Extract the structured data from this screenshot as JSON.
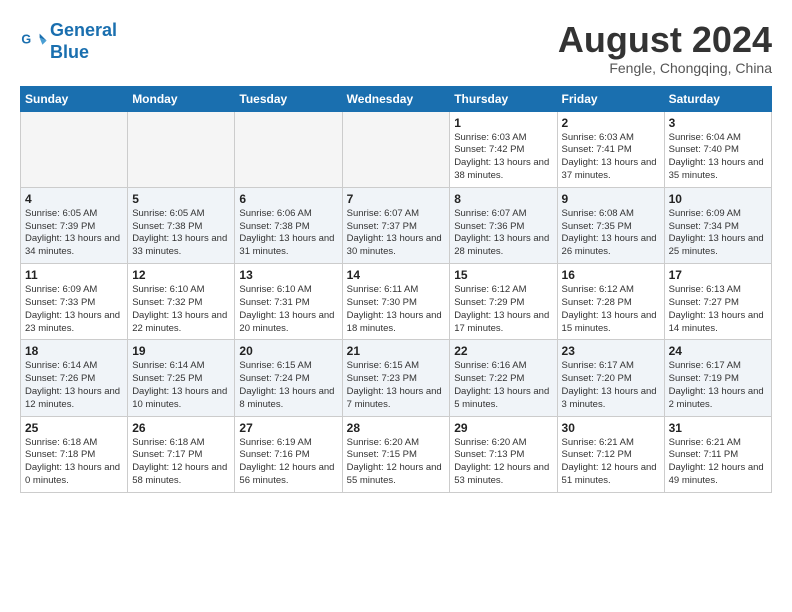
{
  "header": {
    "logo_line1": "General",
    "logo_line2": "Blue",
    "month_year": "August 2024",
    "location": "Fengle, Chongqing, China"
  },
  "weekdays": [
    "Sunday",
    "Monday",
    "Tuesday",
    "Wednesday",
    "Thursday",
    "Friday",
    "Saturday"
  ],
  "weeks": [
    [
      {
        "day": "",
        "empty": true
      },
      {
        "day": "",
        "empty": true
      },
      {
        "day": "",
        "empty": true
      },
      {
        "day": "",
        "empty": true
      },
      {
        "day": "1",
        "sunrise": "6:03 AM",
        "sunset": "7:42 PM",
        "daylight": "13 hours and 38 minutes."
      },
      {
        "day": "2",
        "sunrise": "6:03 AM",
        "sunset": "7:41 PM",
        "daylight": "13 hours and 37 minutes."
      },
      {
        "day": "3",
        "sunrise": "6:04 AM",
        "sunset": "7:40 PM",
        "daylight": "13 hours and 35 minutes."
      }
    ],
    [
      {
        "day": "4",
        "sunrise": "6:05 AM",
        "sunset": "7:39 PM",
        "daylight": "13 hours and 34 minutes."
      },
      {
        "day": "5",
        "sunrise": "6:05 AM",
        "sunset": "7:38 PM",
        "daylight": "13 hours and 33 minutes."
      },
      {
        "day": "6",
        "sunrise": "6:06 AM",
        "sunset": "7:38 PM",
        "daylight": "13 hours and 31 minutes."
      },
      {
        "day": "7",
        "sunrise": "6:07 AM",
        "sunset": "7:37 PM",
        "daylight": "13 hours and 30 minutes."
      },
      {
        "day": "8",
        "sunrise": "6:07 AM",
        "sunset": "7:36 PM",
        "daylight": "13 hours and 28 minutes."
      },
      {
        "day": "9",
        "sunrise": "6:08 AM",
        "sunset": "7:35 PM",
        "daylight": "13 hours and 26 minutes."
      },
      {
        "day": "10",
        "sunrise": "6:09 AM",
        "sunset": "7:34 PM",
        "daylight": "13 hours and 25 minutes."
      }
    ],
    [
      {
        "day": "11",
        "sunrise": "6:09 AM",
        "sunset": "7:33 PM",
        "daylight": "13 hours and 23 minutes."
      },
      {
        "day": "12",
        "sunrise": "6:10 AM",
        "sunset": "7:32 PM",
        "daylight": "13 hours and 22 minutes."
      },
      {
        "day": "13",
        "sunrise": "6:10 AM",
        "sunset": "7:31 PM",
        "daylight": "13 hours and 20 minutes."
      },
      {
        "day": "14",
        "sunrise": "6:11 AM",
        "sunset": "7:30 PM",
        "daylight": "13 hours and 18 minutes."
      },
      {
        "day": "15",
        "sunrise": "6:12 AM",
        "sunset": "7:29 PM",
        "daylight": "13 hours and 17 minutes."
      },
      {
        "day": "16",
        "sunrise": "6:12 AM",
        "sunset": "7:28 PM",
        "daylight": "13 hours and 15 minutes."
      },
      {
        "day": "17",
        "sunrise": "6:13 AM",
        "sunset": "7:27 PM",
        "daylight": "13 hours and 14 minutes."
      }
    ],
    [
      {
        "day": "18",
        "sunrise": "6:14 AM",
        "sunset": "7:26 PM",
        "daylight": "13 hours and 12 minutes."
      },
      {
        "day": "19",
        "sunrise": "6:14 AM",
        "sunset": "7:25 PM",
        "daylight": "13 hours and 10 minutes."
      },
      {
        "day": "20",
        "sunrise": "6:15 AM",
        "sunset": "7:24 PM",
        "daylight": "13 hours and 8 minutes."
      },
      {
        "day": "21",
        "sunrise": "6:15 AM",
        "sunset": "7:23 PM",
        "daylight": "13 hours and 7 minutes."
      },
      {
        "day": "22",
        "sunrise": "6:16 AM",
        "sunset": "7:22 PM",
        "daylight": "13 hours and 5 minutes."
      },
      {
        "day": "23",
        "sunrise": "6:17 AM",
        "sunset": "7:20 PM",
        "daylight": "13 hours and 3 minutes."
      },
      {
        "day": "24",
        "sunrise": "6:17 AM",
        "sunset": "7:19 PM",
        "daylight": "13 hours and 2 minutes."
      }
    ],
    [
      {
        "day": "25",
        "sunrise": "6:18 AM",
        "sunset": "7:18 PM",
        "daylight": "13 hours and 0 minutes."
      },
      {
        "day": "26",
        "sunrise": "6:18 AM",
        "sunset": "7:17 PM",
        "daylight": "12 hours and 58 minutes."
      },
      {
        "day": "27",
        "sunrise": "6:19 AM",
        "sunset": "7:16 PM",
        "daylight": "12 hours and 56 minutes."
      },
      {
        "day": "28",
        "sunrise": "6:20 AM",
        "sunset": "7:15 PM",
        "daylight": "12 hours and 55 minutes."
      },
      {
        "day": "29",
        "sunrise": "6:20 AM",
        "sunset": "7:13 PM",
        "daylight": "12 hours and 53 minutes."
      },
      {
        "day": "30",
        "sunrise": "6:21 AM",
        "sunset": "7:12 PM",
        "daylight": "12 hours and 51 minutes."
      },
      {
        "day": "31",
        "sunrise": "6:21 AM",
        "sunset": "7:11 PM",
        "daylight": "12 hours and 49 minutes."
      }
    ]
  ]
}
